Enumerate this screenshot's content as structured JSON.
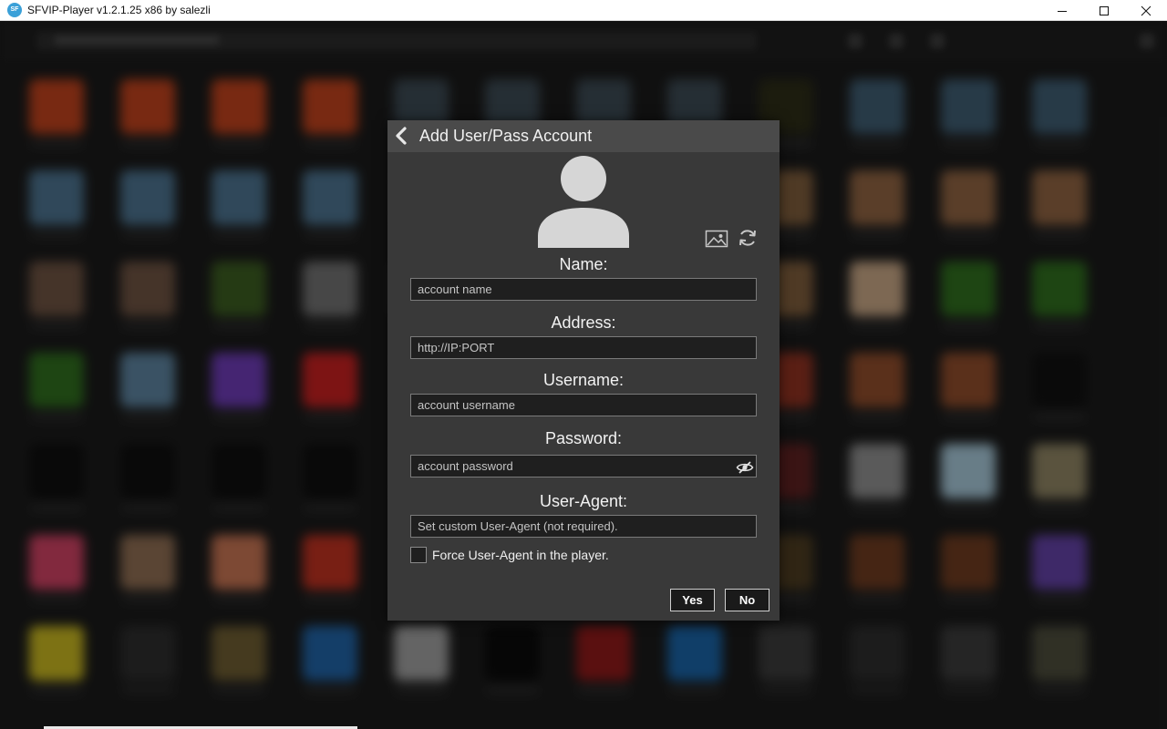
{
  "window": {
    "title": "SFVIP-Player v1.2.1.25 x86 by salezli",
    "icon": "app-logo-icon",
    "controls": [
      "minimize-icon",
      "maximize-icon",
      "close-icon"
    ]
  },
  "dialog": {
    "title": "Add User/Pass Account",
    "fields": {
      "name": {
        "label": "Name:",
        "placeholder": "account name"
      },
      "address": {
        "label": "Address:",
        "placeholder": "http://IP:PORT"
      },
      "username": {
        "label": "Username:",
        "placeholder": "account username"
      },
      "password": {
        "label": "Password:",
        "placeholder": "account password"
      },
      "user_agent": {
        "label": "User-Agent:",
        "placeholder": "Set custom User-Agent (not required)."
      }
    },
    "force_user_agent": {
      "label": "Force User-Agent in the player.",
      "checked": false
    },
    "buttons": {
      "yes": "Yes",
      "no": "No"
    },
    "icons": {
      "back": "chevron-left-icon",
      "avatar": "user-avatar-icon",
      "image": "image-icon",
      "refresh": "refresh-icon",
      "password_toggle": "eye-slash-icon"
    }
  },
  "colors": {
    "dialog_bg": "#393939",
    "header_bg": "#4a4a4a",
    "input_bg": "#1f1f1f",
    "text": "#f2f2f2"
  }
}
